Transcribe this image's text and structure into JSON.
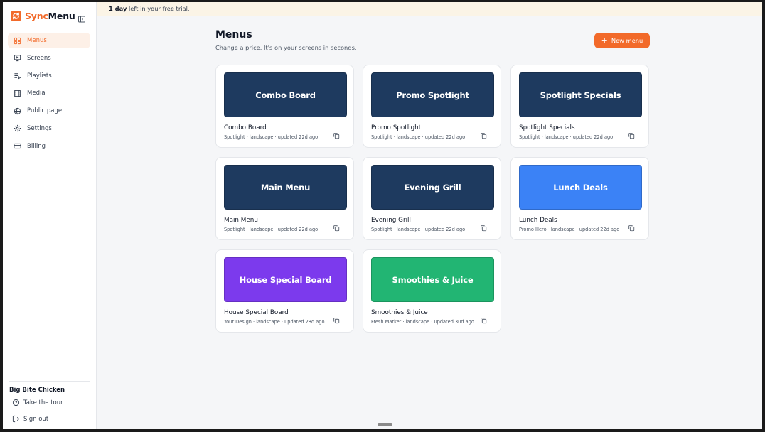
{
  "brand": {
    "part1": "Sync",
    "part2": "Menu"
  },
  "sidebar": {
    "items": [
      {
        "label": "Menus",
        "icon": "grid-icon"
      },
      {
        "label": "Screens",
        "icon": "monitor-icon"
      },
      {
        "label": "Playlists",
        "icon": "playlist-icon"
      },
      {
        "label": "Media",
        "icon": "film-icon"
      },
      {
        "label": "Public page",
        "icon": "globe-icon"
      },
      {
        "label": "Settings",
        "icon": "gear-icon"
      },
      {
        "label": "Billing",
        "icon": "credit-card-icon"
      }
    ],
    "active": "Menus",
    "org_name": "Big Bite Chicken",
    "tour_label": "Take the tour",
    "signout_label": "Sign out"
  },
  "banner": {
    "strong": "1 day",
    "rest": " left in your free trial."
  },
  "main": {
    "title": "Menus",
    "subtitle": "Change a price. It's on your screens in seconds.",
    "new_button": "New menu"
  },
  "menus": [
    {
      "thumb_title": "Combo Board",
      "name": "Combo Board",
      "meta": "Spotlight · landscape · updated 22d ago",
      "color": "#1e3a5f"
    },
    {
      "thumb_title": "Promo Spotlight",
      "name": "Promo Spotlight",
      "meta": "Spotlight · landscape · updated 22d ago",
      "color": "#1e3a5f"
    },
    {
      "thumb_title": "Spotlight Specials",
      "name": "Spotlight Specials",
      "meta": "Spotlight · landscape · updated 22d ago",
      "color": "#1e3a5f"
    },
    {
      "thumb_title": "Main Menu",
      "name": "Main Menu",
      "meta": "Spotlight · landscape · updated 22d ago",
      "color": "#1e3a5f"
    },
    {
      "thumb_title": "Evening Grill",
      "name": "Evening Grill",
      "meta": "Spotlight · landscape · updated 22d ago",
      "color": "#1e3a5f"
    },
    {
      "thumb_title": "Lunch Deals",
      "name": "Lunch Deals",
      "meta": "Promo Hero · landscape · updated 22d ago",
      "color": "#3b82f6"
    },
    {
      "thumb_title": "House Special Board",
      "name": "House Special Board",
      "meta": "Your Design · landscape · updated 28d ago",
      "color": "#7c3aed"
    },
    {
      "thumb_title": "Smoothies & Juice",
      "name": "Smoothies & Juice",
      "meta": "Fresh Market · landscape · updated 30d ago",
      "color": "#22b573"
    }
  ],
  "colors": {
    "accent": "#f26a2a",
    "banner_bg": "#fbf4e6",
    "page_bg": "#f5f6f8"
  }
}
